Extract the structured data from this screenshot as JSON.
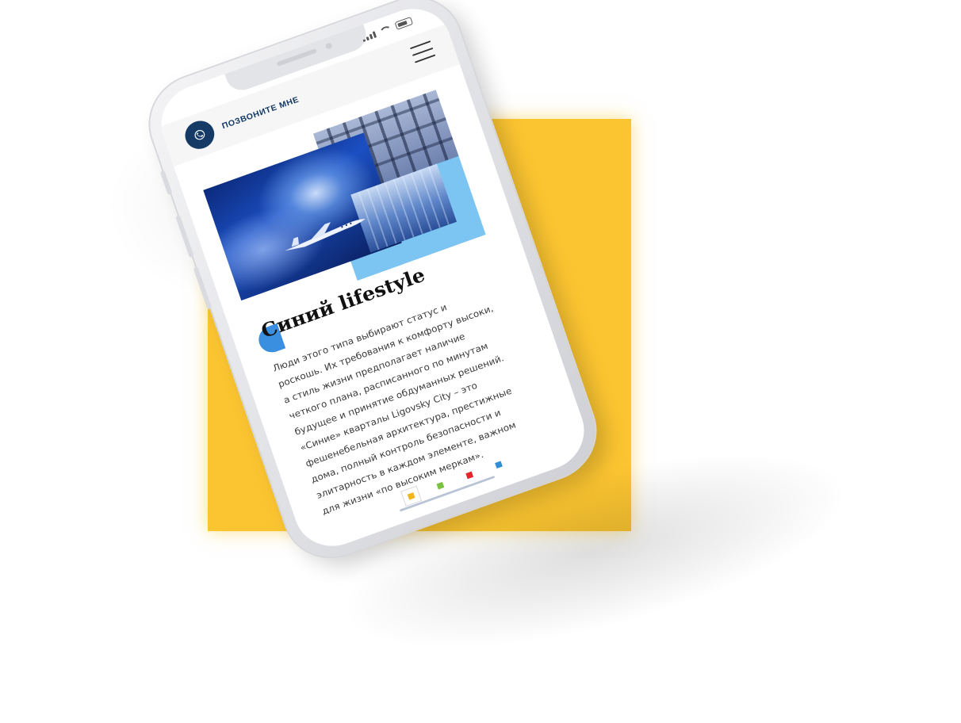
{
  "header": {
    "call_label": "ПОЗВОНИТЕ МНЕ"
  },
  "content": {
    "heading": "Синий lifestyle",
    "paragraph": "Люди этого типа выбирают статус и роскошь. Их требования к комфорту высоки, а стиль жизни предполагает наличие четкого плана, расписанного по минутам будущее и принятие обдуманных решений. «Синие» кварталы Ligovsky City – это фешенебельная архитектура, престижные дома, полный контроль безопасности и элитарность в каждом элементе, важном для жизни «по высоким меркам»."
  },
  "pagination": {
    "dots": [
      {
        "color": "#f2b51d",
        "active": true
      },
      {
        "color": "#7ac142",
        "active": false
      },
      {
        "color": "#e3262c",
        "active": false
      },
      {
        "color": "#2f8fd6",
        "active": false
      }
    ]
  },
  "colors": {
    "background_square": "#fbc531",
    "brand_navy": "#153a66",
    "accent_blue": "#7cc4f1"
  },
  "icons": {
    "call": "phone-icon",
    "menu": "hamburger-menu-icon"
  }
}
